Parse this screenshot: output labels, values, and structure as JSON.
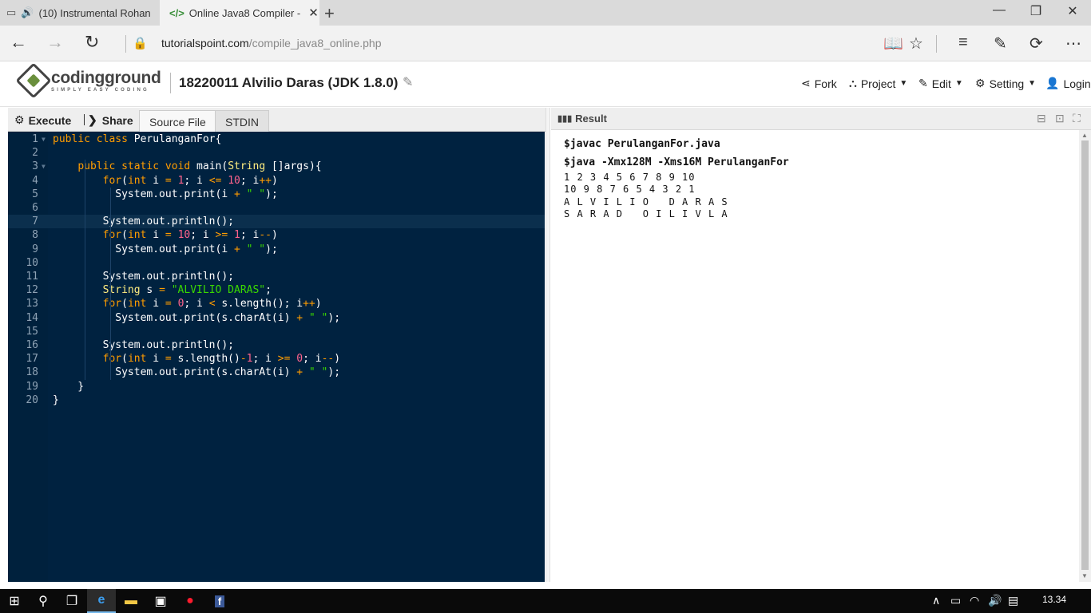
{
  "browser": {
    "tabs": [
      {
        "title": "(10) Instrumental Rohan",
        "icon": "audio-playing-icon"
      },
      {
        "title": "Online Java8 Compiler -",
        "icon": "code-icon"
      }
    ],
    "address": {
      "host": "tutorialspoint.com",
      "path": "/compile_java8_online.php"
    }
  },
  "site": {
    "logo_text": "codingground",
    "logo_tagline": "SIMPLY EASY CODING",
    "project_title": "18220011 Alvilio Daras (JDK 1.8.0)",
    "menu": [
      {
        "label": "Fork",
        "icon": "fork-icon"
      },
      {
        "label": "Project",
        "icon": "sitemap-icon"
      },
      {
        "label": "Edit",
        "icon": "edit-icon"
      },
      {
        "label": "Setting",
        "icon": "gear-icon"
      },
      {
        "label": "Login",
        "icon": "user-icon"
      }
    ]
  },
  "editor_toolbar": {
    "execute": "Execute",
    "share": "Share",
    "tabs": [
      "Source File",
      "STDIN"
    ]
  },
  "code": [
    "public class PerulanganFor{",
    "",
    "    public static void main(String []args){",
    "        for(int i = 1; i <= 10; i++)",
    "          System.out.print(i + \" \");",
    "",
    "        System.out.println();",
    "        for(int i = 10; i >= 1; i--)",
    "          System.out.print(i + \" \");",
    "",
    "        System.out.println();",
    "        String s = \"ALVILIO DARAS\";",
    "        for(int i = 0; i < s.length(); i++)",
    "          System.out.print(s.charAt(i) + \" \");",
    "",
    "        System.out.println();",
    "        for(int i = s.length()-1; i >= 0; i--)",
    "          System.out.print(s.charAt(i) + \" \");",
    "    }",
    "}"
  ],
  "result": {
    "label": "Result",
    "compile_cmd": "$javac PerulanganFor.java",
    "run_cmd": "$java -Xmx128M -Xms16M PerulanganFor",
    "output": [
      "1 2 3 4 5 6 7 8 9 10",
      "10 9 8 7 6 5 4 3 2 1",
      "A L V I L I O   D A R A S",
      "S A R A D   O I L I V L A"
    ]
  },
  "taskbar": {
    "time": "13.34"
  }
}
